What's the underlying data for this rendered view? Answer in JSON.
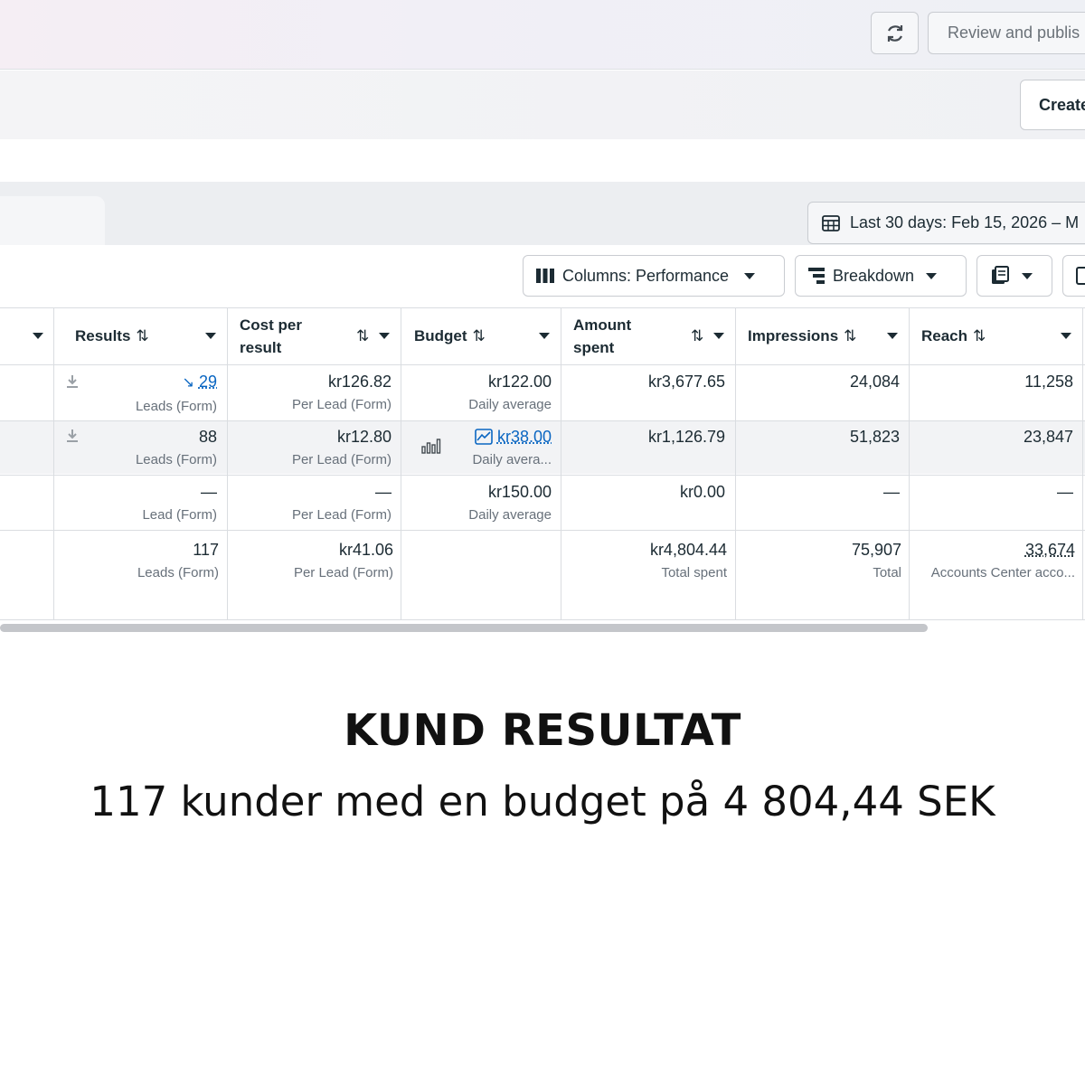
{
  "header": {
    "refresh_icon": "refresh-icon",
    "review_label": "Review and publis",
    "create_label": "Create"
  },
  "toolbar": {
    "date_range": "Last 30 days: Feb 15, 2026 – M",
    "columns_label": "Columns: Performance",
    "breakdown_label": "Breakdown"
  },
  "table": {
    "headers": {
      "results": "Results",
      "cost_per_result_line1": "Cost per",
      "cost_per_result_line2": "result",
      "budget": "Budget",
      "amount_spent_line1": "Amount",
      "amount_spent_line2": "spent",
      "impressions": "Impressions",
      "reach": "Reach"
    },
    "rows": [
      {
        "results": "29",
        "results_sub": "Leads (Form)",
        "cost": "kr126.82",
        "cost_sub": "Per Lead (Form)",
        "budget": "kr122.00",
        "budget_sub": "Daily average",
        "spent": "kr3,677.65",
        "impressions": "24,084",
        "reach": "11,258"
      },
      {
        "results": "88",
        "results_sub": "Leads (Form)",
        "cost": "kr12.80",
        "cost_sub": "Per Lead (Form)",
        "budget": "kr38.00",
        "budget_sub": "Daily avera...",
        "spent": "kr1,126.79",
        "impressions": "51,823",
        "reach": "23,847"
      },
      {
        "results": "—",
        "results_sub": "Lead (Form)",
        "cost": "—",
        "cost_sub": "Per Lead (Form)",
        "budget": "kr150.00",
        "budget_sub": "Daily average",
        "spent": "kr0.00",
        "impressions": "—",
        "reach": "—"
      }
    ],
    "totals": {
      "results": "117",
      "results_sub": "Leads (Form)",
      "cost": "kr41.06",
      "cost_sub": "Per Lead (Form)",
      "spent": "kr4,804.44",
      "spent_sub": "Total spent",
      "impressions": "75,907",
      "impressions_sub": "Total",
      "reach": "33,674",
      "reach_sub": "Accounts Center acco..."
    }
  },
  "caption": {
    "title": "KUND RESULTAT",
    "subtitle": "117 kunder med en budget på 4 804,44 SEK"
  },
  "colors": {
    "link": "#0a66c2",
    "text": "#1c2b33",
    "muted": "#67707a"
  }
}
